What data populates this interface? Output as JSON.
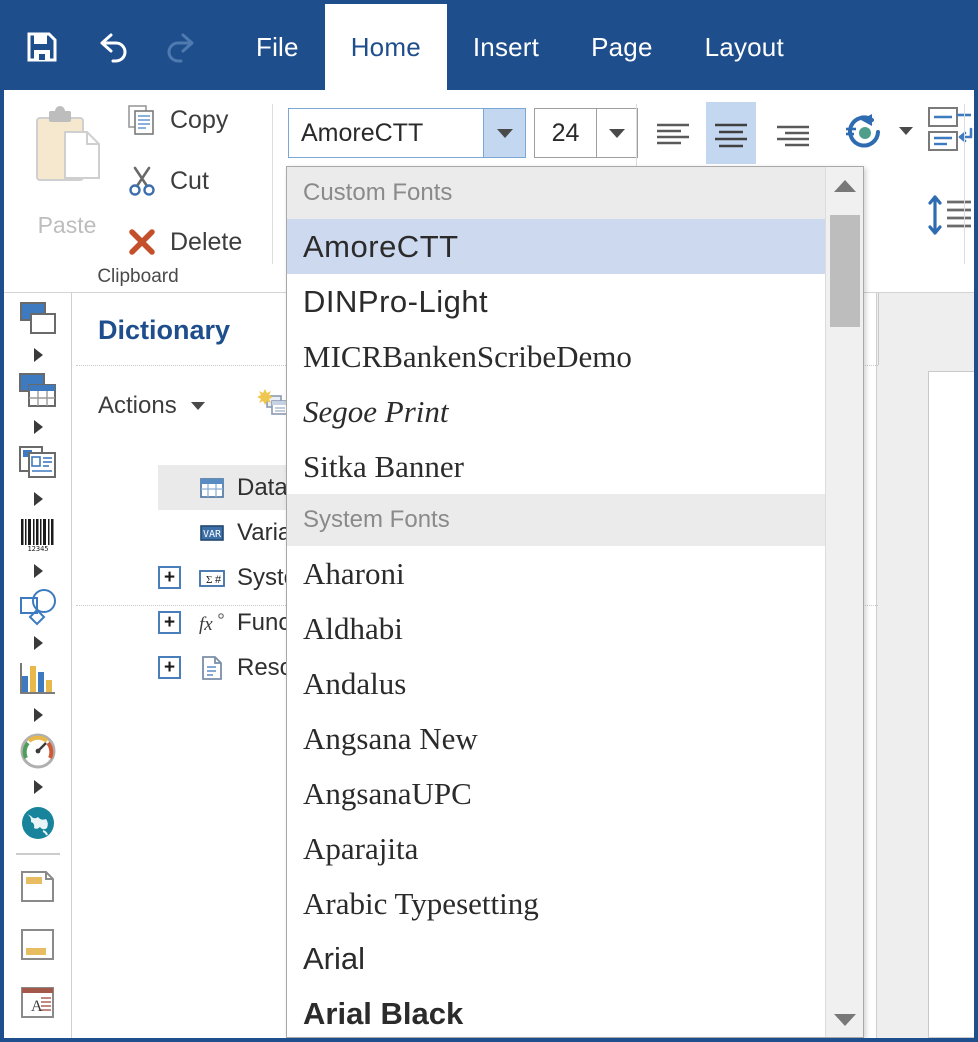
{
  "window": {
    "quick_access": [
      {
        "name": "save-icon",
        "label": "Save"
      },
      {
        "name": "undo-icon",
        "label": "Undo"
      },
      {
        "name": "redo-icon",
        "label": "Redo"
      }
    ],
    "tabs": [
      {
        "label": "File",
        "active": false
      },
      {
        "label": "Home",
        "active": true
      },
      {
        "label": "Insert",
        "active": false
      },
      {
        "label": "Page",
        "active": false
      },
      {
        "label": "Layout",
        "active": false
      }
    ]
  },
  "ribbon": {
    "clipboard": {
      "group_label": "Clipboard",
      "paste_label": "Paste",
      "copy_label": "Copy",
      "cut_label": "Cut",
      "delete_label": "Delete"
    },
    "font": {
      "font_name_value": "AmoreCTT",
      "font_size_value": "24"
    },
    "paragraph": {
      "align_left": "Align Left",
      "align_center": "Align Center",
      "align_right": "Align Right",
      "rotate_label": "Text Rotation",
      "wrap_label": "Text Wrap",
      "line_spacing_label": "Line Spacing"
    }
  },
  "sidebar": {
    "items": [
      {
        "name": "sidebar-item-label",
        "icon": "label-icon",
        "has_arrow": true
      },
      {
        "name": "sidebar-item-table",
        "icon": "table-icon",
        "has_arrow": true
      },
      {
        "name": "sidebar-item-card",
        "icon": "card-icon",
        "has_arrow": true
      },
      {
        "name": "sidebar-item-barcode",
        "icon": "barcode-icon",
        "has_arrow": true
      },
      {
        "name": "sidebar-item-shapes",
        "icon": "shapes-icon",
        "has_arrow": true
      },
      {
        "name": "sidebar-item-chart",
        "icon": "chart-icon",
        "has_arrow": true
      },
      {
        "name": "sidebar-item-gauge",
        "icon": "gauge-icon",
        "has_arrow": true
      },
      {
        "name": "sidebar-item-globe",
        "icon": "globe-icon",
        "has_arrow": false
      },
      {
        "name": "sidebar-item-header",
        "icon": "header-icon",
        "has_arrow": false
      },
      {
        "name": "sidebar-item-footer",
        "icon": "footer-icon",
        "has_arrow": false
      },
      {
        "name": "sidebar-item-textbox",
        "icon": "textbox-icon",
        "has_arrow": false
      }
    ]
  },
  "dictionary": {
    "title": "Dictionary",
    "actions_label": "Actions",
    "pin_icon": "pin-icon",
    "new_icon": "new-item-icon",
    "tree": [
      {
        "label": "Data Sources",
        "icon": "data-source-icon",
        "expandable": false,
        "selected": true
      },
      {
        "label": "Variables",
        "icon": "variables-icon",
        "expandable": false,
        "selected": false
      },
      {
        "label": "System Variables",
        "icon": "system-variables-icon",
        "expandable": true,
        "selected": false
      },
      {
        "label": "Functions",
        "icon": "functions-icon",
        "expandable": true,
        "selected": false
      },
      {
        "label": "Resources",
        "icon": "resources-icon",
        "expandable": true,
        "selected": false
      }
    ]
  },
  "font_dropdown": {
    "sections": [
      {
        "header": "Custom Fonts",
        "items": [
          {
            "label": "AmoreCTT",
            "style": "f-sans f-light",
            "highlight": true
          },
          {
            "label": "DINPro-Light",
            "style": "f-sans f-light",
            "highlight": false
          },
          {
            "label": "MICRBankenScribeDemo",
            "style": "f-serif",
            "highlight": false
          },
          {
            "label": "Segoe Print",
            "style": "f-serif f-italic",
            "highlight": false
          },
          {
            "label": "Sitka Banner",
            "style": "f-serif",
            "highlight": false
          }
        ]
      },
      {
        "header": "System Fonts",
        "items": [
          {
            "label": "Aharoni",
            "style": "f-serif",
            "highlight": false
          },
          {
            "label": "Aldhabi",
            "style": "f-serif",
            "highlight": false
          },
          {
            "label": "Andalus",
            "style": "f-serif",
            "highlight": false
          },
          {
            "label": "Angsana New",
            "style": "f-serif",
            "highlight": false
          },
          {
            "label": "AngsanaUPC",
            "style": "f-serif",
            "highlight": false
          },
          {
            "label": "Aparajita",
            "style": "f-serif",
            "highlight": false
          },
          {
            "label": "Arabic Typesetting",
            "style": "f-serif",
            "highlight": false
          },
          {
            "label": "Arial",
            "style": "f-sans",
            "highlight": false
          },
          {
            "label": "Arial Black",
            "style": "f-sans f-bold",
            "highlight": false
          }
        ]
      }
    ],
    "scrollbar": {
      "up_icon": "scroll-up-arrow-icon",
      "down_icon": "scroll-down-arrow-icon"
    }
  },
  "colors": {
    "chrome_blue": "#1f4e8c",
    "accent_highlight": "#cdd9ef",
    "section_header_bg": "#ebebeb",
    "delete_red": "#c4502b"
  }
}
